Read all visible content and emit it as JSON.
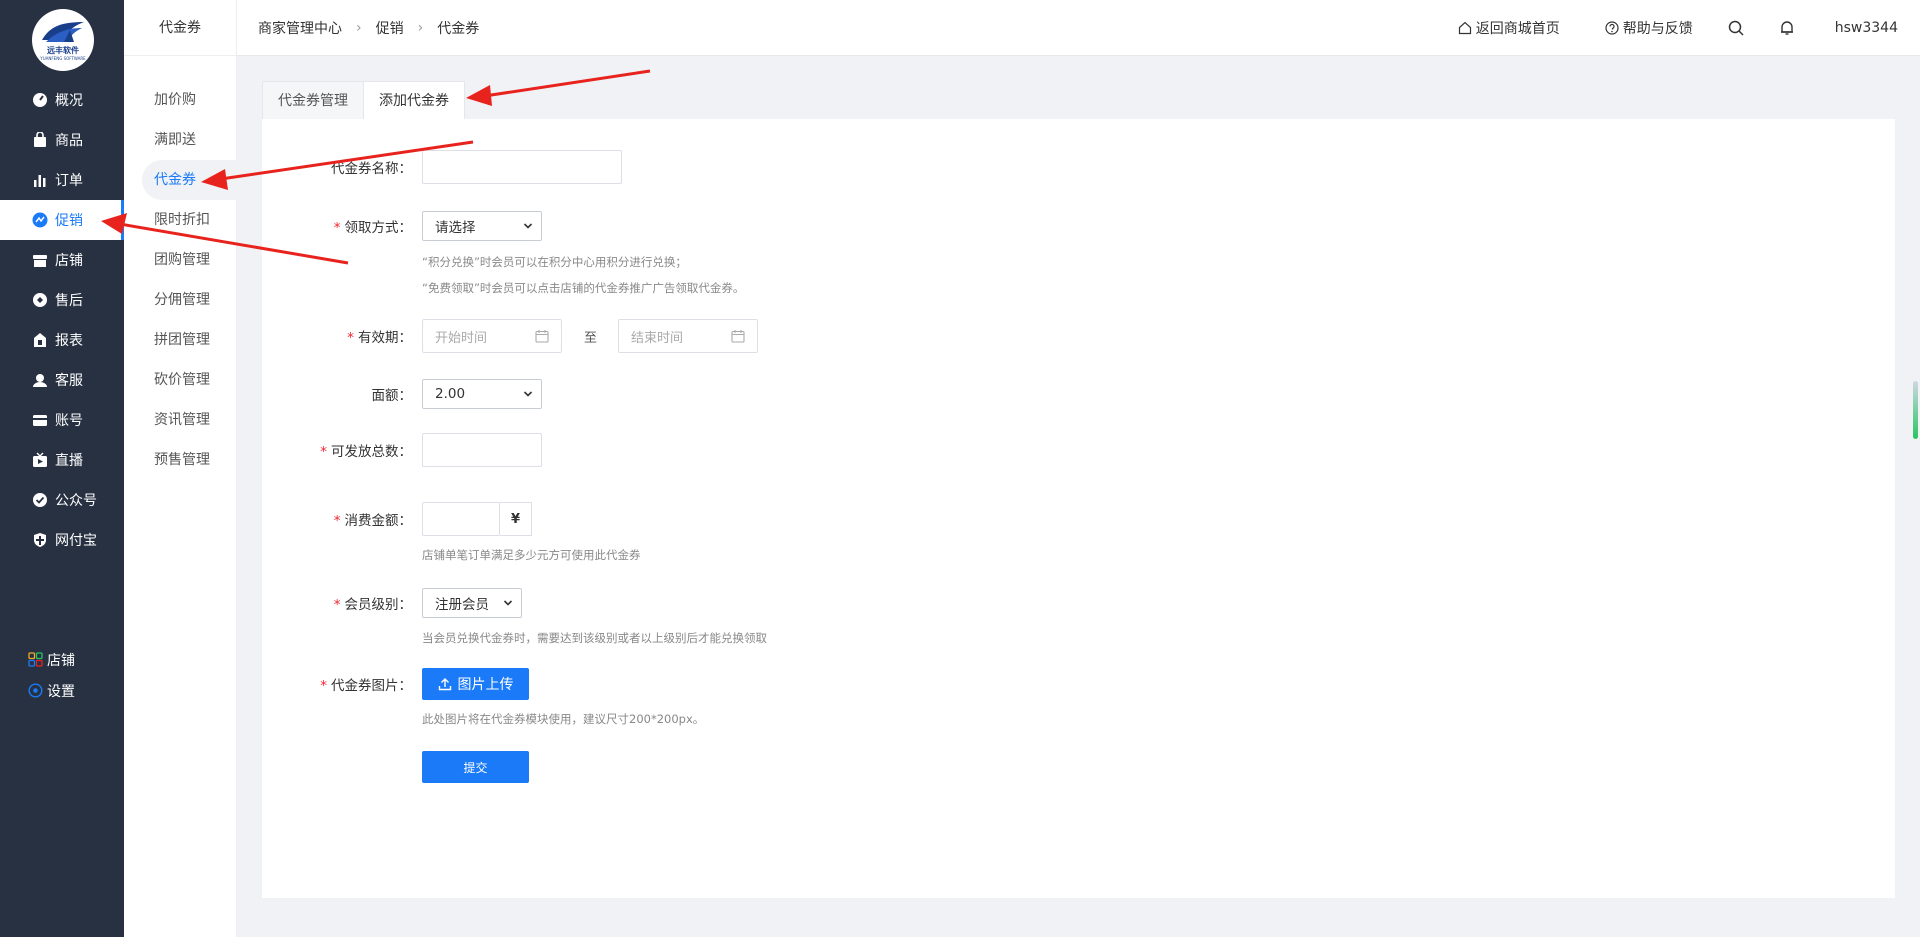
{
  "app": {
    "logo_text": "远丰软件",
    "logo_sub": "YUANFENG SOFTWARE"
  },
  "sidebar": {
    "items": [
      {
        "label": "概况",
        "icon": "dashboard-icon"
      },
      {
        "label": "商品",
        "icon": "bag-icon"
      },
      {
        "label": "订单",
        "icon": "bar-chart-icon"
      },
      {
        "label": "促销",
        "icon": "promotion-icon"
      },
      {
        "label": "店铺",
        "icon": "store-icon"
      },
      {
        "label": "售后",
        "icon": "after-sale-icon"
      },
      {
        "label": "报表",
        "icon": "report-icon"
      },
      {
        "label": "客服",
        "icon": "customer-service-icon"
      },
      {
        "label": "账号",
        "icon": "account-card-icon"
      },
      {
        "label": "直播",
        "icon": "live-icon"
      },
      {
        "label": "公众号",
        "icon": "official-account-icon"
      },
      {
        "label": "网付宝",
        "icon": "shield-pay-icon"
      }
    ],
    "active_index": 3,
    "bottom": [
      {
        "label": "店铺",
        "icon": "grid-icon"
      },
      {
        "label": "设置",
        "icon": "settings-icon"
      }
    ]
  },
  "submenu": {
    "title": "代金券",
    "items": [
      "加价购",
      "满即送",
      "代金券",
      "限时折扣",
      "团购管理",
      "分佣管理",
      "拼团管理",
      "砍价管理",
      "资讯管理",
      "预售管理"
    ],
    "active_index": 2
  },
  "header": {
    "breadcrumb": [
      "商家管理中心",
      "促销",
      "代金券"
    ],
    "home_link": "返回商城首页",
    "help_link": "帮助与反馈",
    "username": "hsw3344"
  },
  "tabs": [
    {
      "label": "代金券管理",
      "active": false
    },
    {
      "label": "添加代金券",
      "active": true
    }
  ],
  "form": {
    "name_label": "代金券名称：",
    "receive_label": "领取方式：",
    "receive_value": "请选择",
    "receive_hint1": "“积分兑换”时会员可以在积分中心用积分进行兑换；",
    "receive_hint2": "“免费领取”时会员可以点击店铺的代金券推广广告领取代金券。",
    "validity_label": "有效期：",
    "start_placeholder": "开始时间",
    "to_text": "至",
    "end_placeholder": "结束时间",
    "face_label": "面额：",
    "face_value": "2.00",
    "total_label": "可发放总数：",
    "consume_label": "消费金额：",
    "currency": "¥",
    "consume_hint": "店铺单笔订单满足多少元方可使用此代金券",
    "member_label": "会员级别：",
    "member_value": "注册会员",
    "member_hint": "当会员兑换代金券时，需要达到该级别或者以上级别后才能兑换领取",
    "image_label": "代金券图片：",
    "upload_button": "图片上传",
    "image_hint": "此处图片将在代金券模块使用，建议尺寸200*200px。",
    "submit_button": "提交"
  },
  "colors": {
    "sidebar_bg": "#273142",
    "accent": "#1a7af8",
    "required": "#f5222d",
    "annotation_arrow": "#e8231d"
  }
}
